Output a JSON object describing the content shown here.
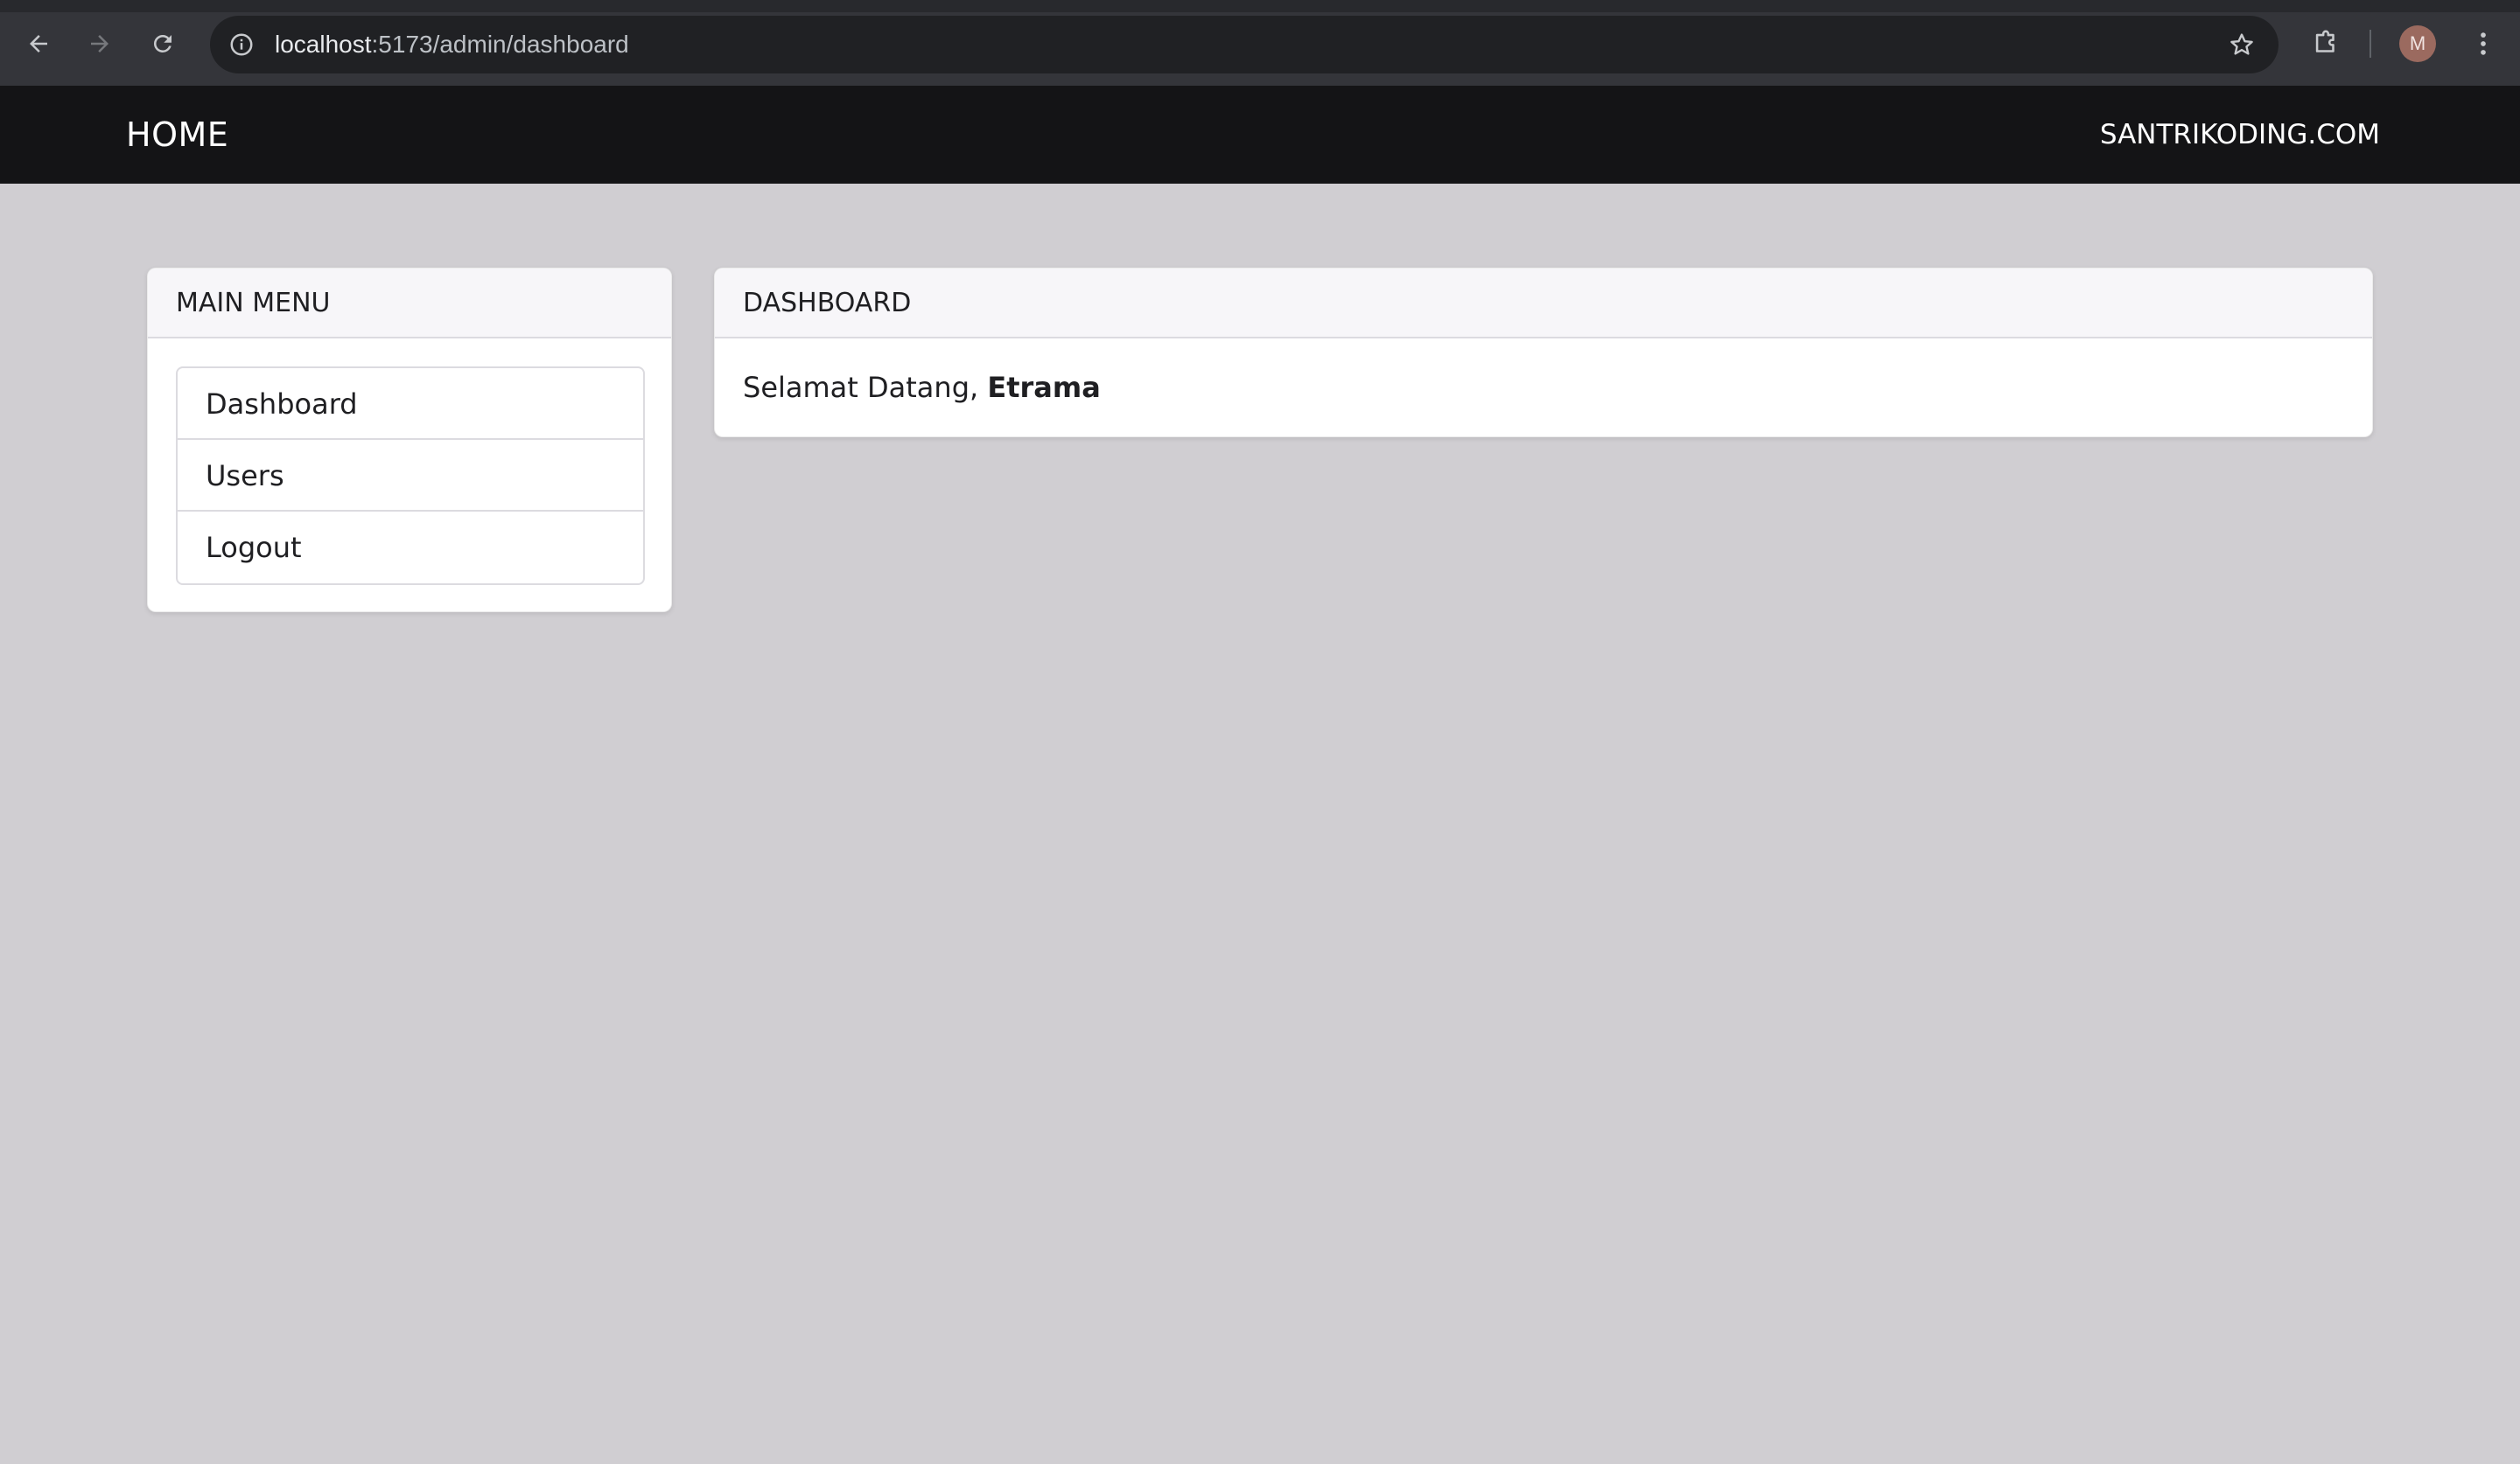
{
  "browser": {
    "url_host": "localhost",
    "url_path": ":5173/admin/dashboard",
    "avatar_letter": "M",
    "icons": [
      "back-arrow-icon",
      "forward-arrow-icon",
      "reload-icon",
      "site-info-icon",
      "bookmark-star-icon",
      "extensions-icon",
      "more-menu-icon"
    ]
  },
  "navbar": {
    "brand": "HOME",
    "right_link": "SANTRIKODING.COM"
  },
  "sidebar": {
    "title": "MAIN MENU",
    "items": [
      {
        "label": "Dashboard"
      },
      {
        "label": "Users"
      },
      {
        "label": "Logout"
      }
    ]
  },
  "dashboard": {
    "title": "DASHBOARD",
    "greeting": "Selamat Datang,",
    "username": "Etrama"
  },
  "colors": {
    "page_bg": "#d0ced2",
    "navbar_bg": "#141416",
    "card_bg": "#ffffff",
    "card_header_bg": "#f7f6f9"
  }
}
